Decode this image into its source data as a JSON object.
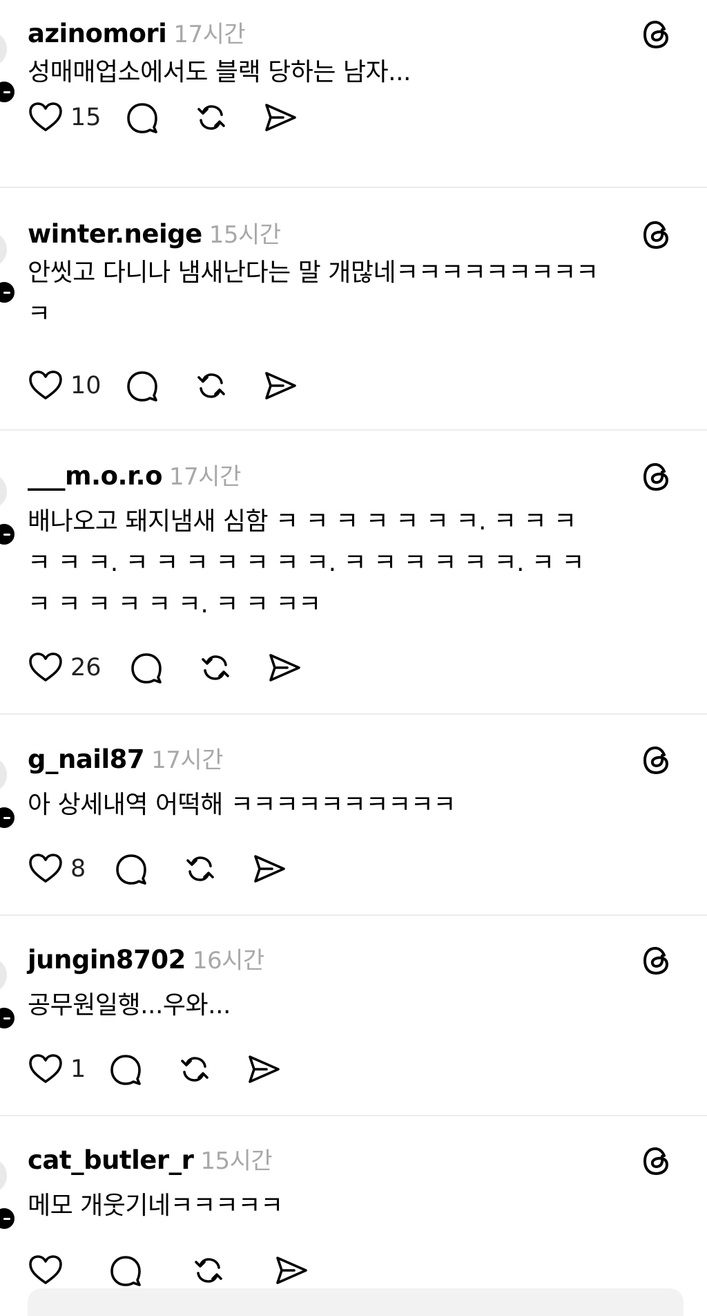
{
  "posts": [
    {
      "username": "azinomori",
      "time": "17시간",
      "lines": [
        "성매매업소에서도 블랙 당하는 남자..."
      ],
      "likes": "15"
    },
    {
      "username": "winter.neige",
      "time": "15시간",
      "lines": [
        "안씻고 다니나 냄새난다는 말 개많네ㅋㅋㅋㅋㅋㅋㅋㅋㅋ",
        "ㅋ"
      ],
      "likes": "10"
    },
    {
      "username": "___m.o.r.o",
      "time": "17시간",
      "lines": [
        "배나오고 돼지냄새 심함 ㅋ ㅋ ㅋ ㅋ ㅋ ㅋ ㅋ. ㅋ ㅋ ㅋ",
        "ㅋ ㅋ ㅋ. ㅋ ㅋ ㅋ ㅋ ㅋ ㅋ ㅋ. ㅋ ㅋ ㅋ ㅋ ㅋ ㅋ. ㅋ ㅋ",
        "ㅋ ㅋ ㅋ ㅋ ㅋ ㅋ. ㅋ ㅋ ㅋㅋ"
      ],
      "likes": "26"
    },
    {
      "username": "g_nail87",
      "time": "17시간",
      "lines": [
        "아 상세내역 어떡해 ㅋㅋㅋㅋㅋㅋㅋㅋㅋㅋ"
      ],
      "likes": "8"
    },
    {
      "username": "jungin8702",
      "time": "16시간",
      "lines": [
        "공무원일행...우와..."
      ],
      "likes": "1"
    },
    {
      "username": "cat_butler_r",
      "time": "15시간",
      "lines": [
        "메모 개웃기네ㅋㅋㅋㅋㅋ"
      ],
      "likes": ""
    }
  ],
  "icons": {
    "like": "heart-icon",
    "reply": "comment-bubble-icon",
    "repost": "repost-icon",
    "share": "send-icon",
    "brand": "threads-logo-icon"
  },
  "colors": {
    "timestamp": "#a8a8a8",
    "divider": "#ebebeb",
    "text": "#000000"
  }
}
